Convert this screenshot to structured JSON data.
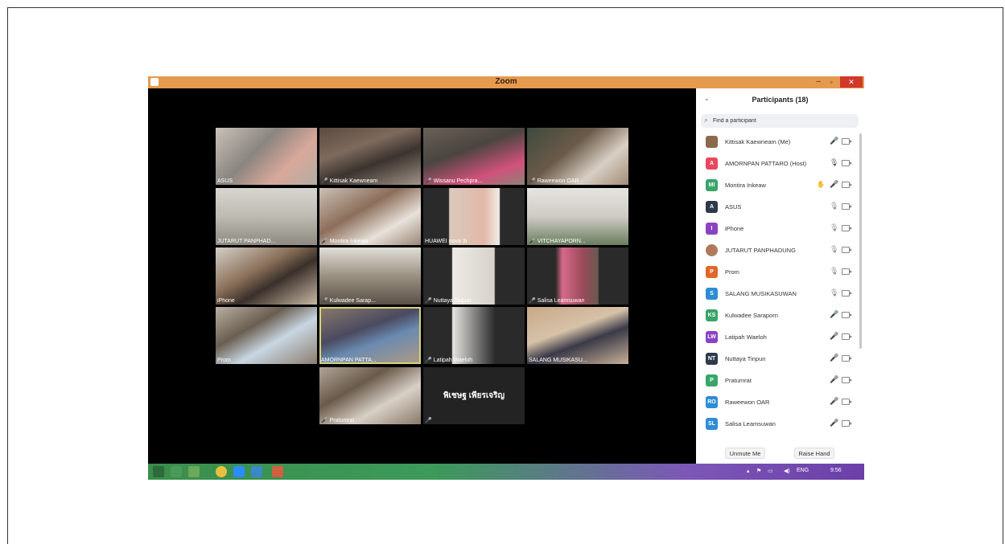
{
  "window": {
    "title": "Zoom",
    "minimize": "–",
    "maximize": "▫",
    "close": "✕"
  },
  "colors": {
    "titlebar": "#e59a4e",
    "close_button": "#d0392b",
    "muted_mic": "#e23232",
    "active_speaker_border": "#d6d27a"
  },
  "gallery": [
    {
      "name": "ASUS",
      "muted": false
    },
    {
      "name": "Kittisak Kaewneam",
      "muted": true
    },
    {
      "name": "Wissanu Pechpra...",
      "muted": true
    },
    {
      "name": "Raweewon OAR",
      "muted": true
    },
    {
      "name": "JUTARUT PANPHAD...",
      "muted": false
    },
    {
      "name": "Montira Inkeaw",
      "muted": true
    },
    {
      "name": "HUAWEI nova 3i",
      "muted": false
    },
    {
      "name": "VITCHAYAPORN...",
      "muted": true
    },
    {
      "name": "iPhone",
      "muted": false
    },
    {
      "name": "Kulwadee Sarap...",
      "muted": true
    },
    {
      "name": "Nuttaya Tinpun",
      "muted": true
    },
    {
      "name": "Salisa Leamsuwan",
      "muted": true
    },
    {
      "name": "Prom",
      "muted": false
    },
    {
      "name": "AMORNPAN PATTA...",
      "muted": false
    },
    {
      "name": "Latipah Waeloh",
      "muted": true
    },
    {
      "name": "SALANG MUSIKASU...",
      "muted": false
    },
    {
      "name": "Pratumrat",
      "muted": true
    },
    {
      "name": "",
      "muted": true,
      "center_text": "พิเชษฐ เพียรเจริญ"
    }
  ],
  "participants": {
    "title": "Participants (18)",
    "collapse_icon": "⌄",
    "search_placeholder": "Find a participant",
    "list": [
      {
        "initials": "",
        "name": "Kittisak Kaewneam (Me)",
        "color": "#8a6a4a",
        "mic": "muted"
      },
      {
        "initials": "A",
        "name": "AMORNPAN PATTARO (Host)",
        "color": "#e8475f",
        "mic": "on"
      },
      {
        "initials": "MI",
        "name": "Montira Inkeaw",
        "color": "#3aa56a",
        "mic": "muted",
        "raised": true
      },
      {
        "initials": "A",
        "name": "ASUS",
        "color": "#2e3a4c",
        "mic": "open"
      },
      {
        "initials": "I",
        "name": "iPhone",
        "color": "#8a44c2",
        "mic": "open"
      },
      {
        "initials": "",
        "name": "JUTARUT PANPHADUNG",
        "color": "#b07a5a",
        "mic": "open"
      },
      {
        "initials": "P",
        "name": "Prom",
        "color": "#e0662a",
        "mic": "open"
      },
      {
        "initials": "S",
        "name": "SALANG MUSIKASUWAN",
        "color": "#2d8cd4",
        "mic": "open"
      },
      {
        "initials": "KS",
        "name": "Kulwadee Saraporn",
        "color": "#3aa56a",
        "mic": "muted"
      },
      {
        "initials": "LW",
        "name": "Latipah Waeloh",
        "color": "#8a44c2",
        "mic": "muted"
      },
      {
        "initials": "NT",
        "name": "Nuttaya Tinpun",
        "color": "#2e3a4c",
        "mic": "muted"
      },
      {
        "initials": "P",
        "name": "Pratumrat",
        "color": "#3aa56a",
        "mic": "muted"
      },
      {
        "initials": "RO",
        "name": "Raweewon OAR",
        "color": "#2d8cd4",
        "mic": "muted"
      },
      {
        "initials": "SL",
        "name": "Salisa Leamsuwan",
        "color": "#2d8cd4",
        "mic": "muted"
      }
    ],
    "unmute_button": "Unmute Me",
    "raise_hand_button": "Raise Hand"
  },
  "taskbar": {
    "language": "ENG",
    "time": "9:56"
  }
}
